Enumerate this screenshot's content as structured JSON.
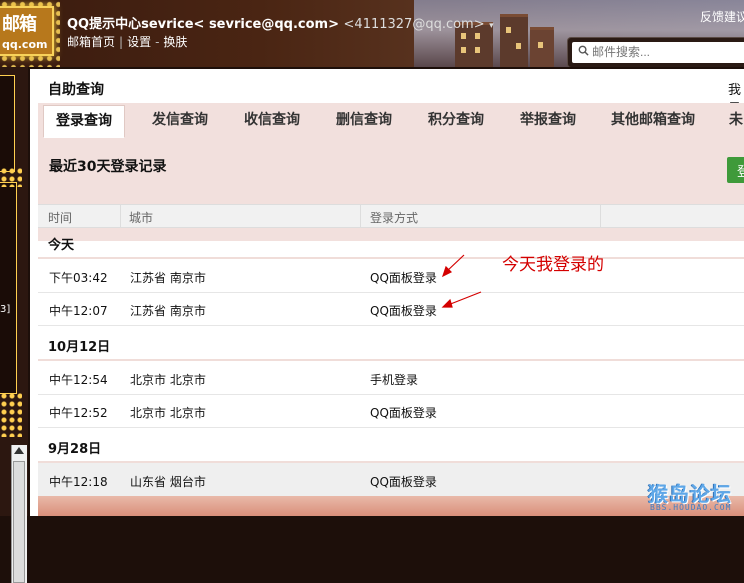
{
  "header": {
    "logo_line1": "邮箱",
    "logo_line2": "qq.com",
    "account_name": "QQ提示中心sevrice< sevrice@qq.com>",
    "account_qq": "<4111327@qq.com>",
    "caret": "▾",
    "links": [
      "邮箱首页",
      "设置",
      "换肤"
    ],
    "link_sep": "|",
    "link_sep2": "-",
    "feedback": "反馈建议",
    "search_placeholder": "邮件搜索..."
  },
  "sidebar": {
    "tag": "3]"
  },
  "panel": {
    "title": "自助查询",
    "me": "我是",
    "tabs": [
      "登录查询",
      "发信查询",
      "收信查询",
      "删信查询",
      "积分查询",
      "举报查询",
      "其他邮箱查询",
      "未"
    ],
    "active_tab": "登录查询",
    "section_title": "最近30天登录记录",
    "green_button": "登",
    "columns": [
      "时间",
      "城市",
      "登录方式"
    ]
  },
  "groups": [
    {
      "label": "今天",
      "rows": [
        {
          "time": "下午03:42",
          "city": "江苏省 南京市",
          "method": "QQ面板登录"
        },
        {
          "time": "中午12:07",
          "city": "江苏省 南京市",
          "method": "QQ面板登录"
        }
      ]
    },
    {
      "label": "10月12日",
      "rows": [
        {
          "time": "中午12:54",
          "city": "北京市 北京市",
          "method": "手机登录"
        },
        {
          "time": "中午12:52",
          "city": "北京市 北京市",
          "method": "QQ面板登录"
        }
      ]
    },
    {
      "label": "9月28日",
      "rows": [
        {
          "time": "中午12:18",
          "city": "山东省 烟台市",
          "method": "QQ面板登录"
        }
      ]
    }
  ],
  "annotation": "今天我登录的",
  "watermark": {
    "title": "猴岛论坛",
    "url": "BBS.HOUDAO.COM"
  },
  "colors": {
    "accent_annotation": "#d40000",
    "tab_band": "#f2e0dd",
    "green": "#3f9a3a"
  }
}
